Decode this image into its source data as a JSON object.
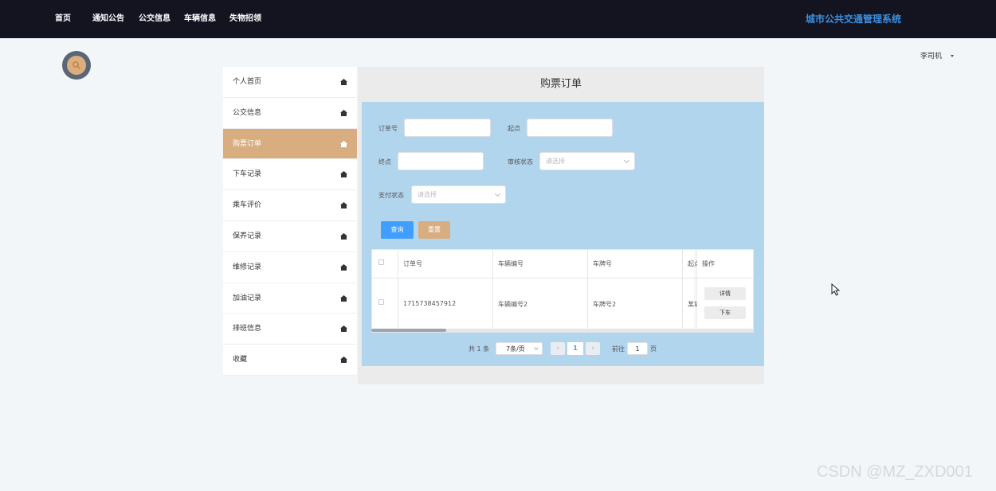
{
  "nav": {
    "items": [
      {
        "label": "首页"
      },
      {
        "label": "通知公告"
      },
      {
        "label": "公交信息"
      },
      {
        "label": "车辆信息"
      },
      {
        "label": "失物招领"
      }
    ],
    "system_title": "城市公共交通管理系统"
  },
  "user": {
    "name": "李司机"
  },
  "sidebar": {
    "items": [
      {
        "label": "个人首页"
      },
      {
        "label": "公交信息"
      },
      {
        "label": "购票订单",
        "active": true
      },
      {
        "label": "下车记录"
      },
      {
        "label": "乘车评价"
      },
      {
        "label": "保养记录"
      },
      {
        "label": "维修记录"
      },
      {
        "label": "加油记录"
      },
      {
        "label": "排班信息"
      },
      {
        "label": "收藏"
      }
    ]
  },
  "page": {
    "title": "购票订单"
  },
  "filters": {
    "order_no_label": "订单号",
    "start_label": "起点",
    "end_label": "终点",
    "audit_label": "审核状态",
    "audit_placeholder": "请选择",
    "pay_label": "支付状态",
    "pay_placeholder": "请选择",
    "search_button": "查询",
    "reset_button": "重置"
  },
  "table": {
    "columns": [
      "订单号",
      "车辆编号",
      "车牌号",
      "起点",
      "操作"
    ],
    "rows": [
      {
        "order_no": "1715738457912",
        "vehicle_no": "车辆编号2",
        "plate": "车牌号2",
        "start": "某站"
      }
    ],
    "actions": {
      "detail": "详情",
      "alight": "下车"
    }
  },
  "pagination": {
    "total_text": "共 1 条",
    "page_size": "7条/页",
    "prev": "‹",
    "current": "1",
    "next": "›",
    "goto_label": "前往",
    "goto_value": "1",
    "page_suffix": "页"
  },
  "watermark": "CSDN @MZ_ZXD001",
  "colors": {
    "topbar": "#141421",
    "title_blue": "#3a8fe0",
    "accent_tan": "#d8ad80",
    "panel_blue": "#b2d5ee",
    "primary_button": "#409eff"
  }
}
